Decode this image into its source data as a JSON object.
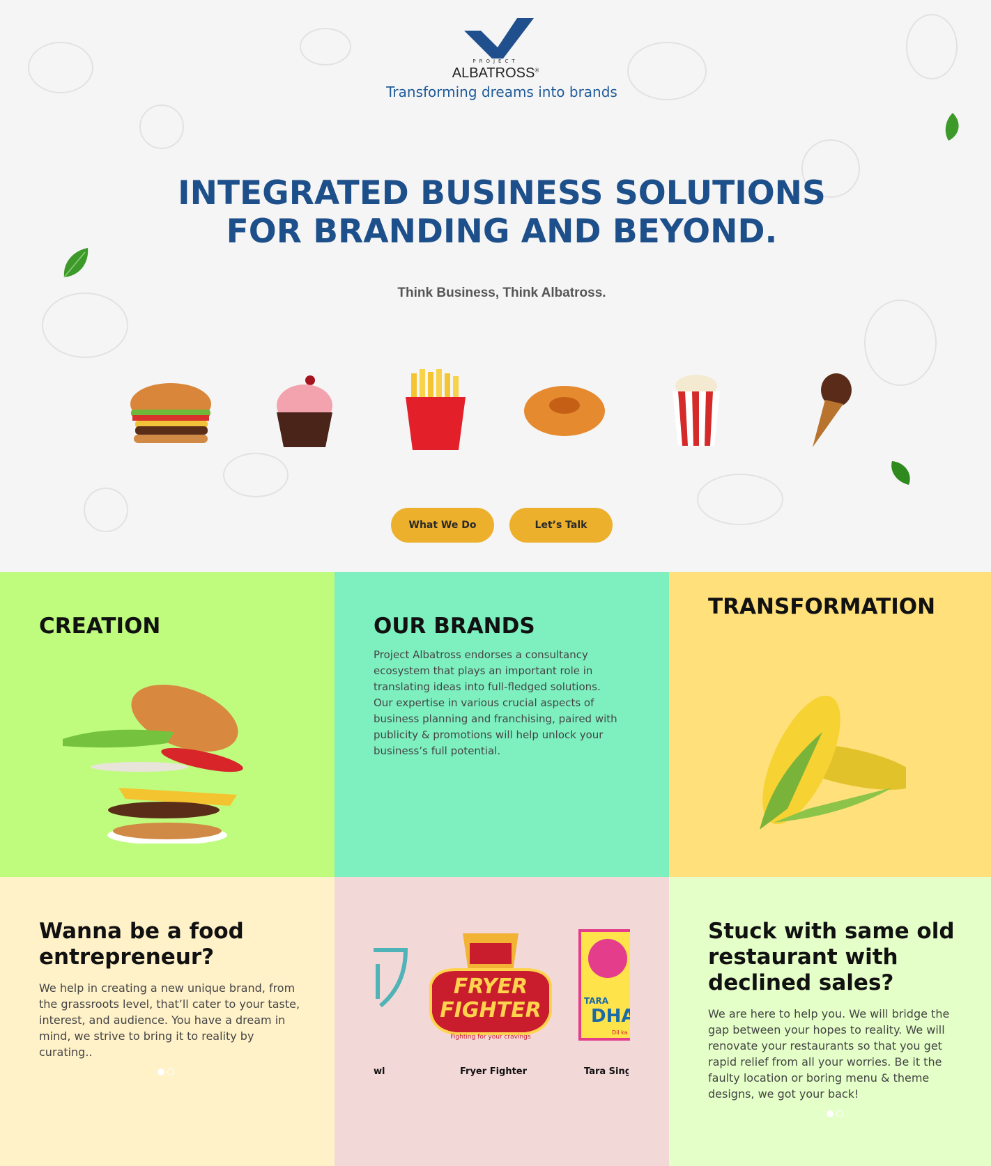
{
  "header": {
    "logo_project": "PROJECT",
    "logo_name": "ALBATROSS",
    "logo_reg": "®",
    "tagline": "Transforming dreams into brands"
  },
  "hero": {
    "headline_line1": "INTEGRATED BUSINESS SOLUTIONS",
    "headline_line2": "FOR BRANDING AND BEYOND.",
    "subline": "Think Business, Think Albatross.",
    "foods": [
      "burger-icon",
      "cupcake-icon",
      "fries-icon",
      "donut-icon",
      "popcorn-icon",
      "ice-cream-cone-icon"
    ],
    "buttons": {
      "what_we_do": "What We Do",
      "lets_talk": "Let’s Talk"
    }
  },
  "tiles": {
    "creation": {
      "title": "CREATION",
      "bg": "#bffc7e"
    },
    "our_brands": {
      "title": "OUR BRANDS",
      "body": "Project Albatross endorses a consultancy ecosystem that plays an important role in translating ideas into full-fledged solutions. Our expertise in various crucial aspects of business planning and franchising, paired with publicity & promotions will help unlock your business’s full potential.",
      "bg": "#7ef0c0"
    },
    "transformation": {
      "title": "TRANSFORMATION",
      "bg": "#ffe07a"
    },
    "food_entrepreneur": {
      "title": "Wanna be a food entrepreneur?",
      "body": "We help in creating a new unique brand, from the grassroots level, that’ll cater to your taste, interest, and audience. You have a dream in mind, we strive to bring it to reality by curating..",
      "bg": "#fff1c8"
    },
    "brands_carousel": {
      "bg": "#f3d8d8",
      "items": [
        {
          "label": "wl"
        },
        {
          "label": "Fryer Fighter",
          "logo_line1": "FRYER",
          "logo_line2": "FIGHTER",
          "logo_tag": "Fighting for your cravings"
        },
        {
          "label": "Tara Sing",
          "logo_text": "TARA",
          "logo_text2": "DHA",
          "logo_small": "Dil ka"
        }
      ]
    },
    "restaurant": {
      "title": "Stuck with same old restaurant with declined sales?",
      "body": "We are here to help you. We will bridge the gap between your hopes to reality. We will renovate your restaurants so that you get rapid relief from all your worries. Be it the faulty location or boring menu & theme designs, we got your back!",
      "bg": "#e4ffc8"
    }
  },
  "colors": {
    "brand_blue": "#1d4f8a",
    "accent_yellow": "#ecb02c",
    "leaf_green": "#2f8a1e"
  }
}
